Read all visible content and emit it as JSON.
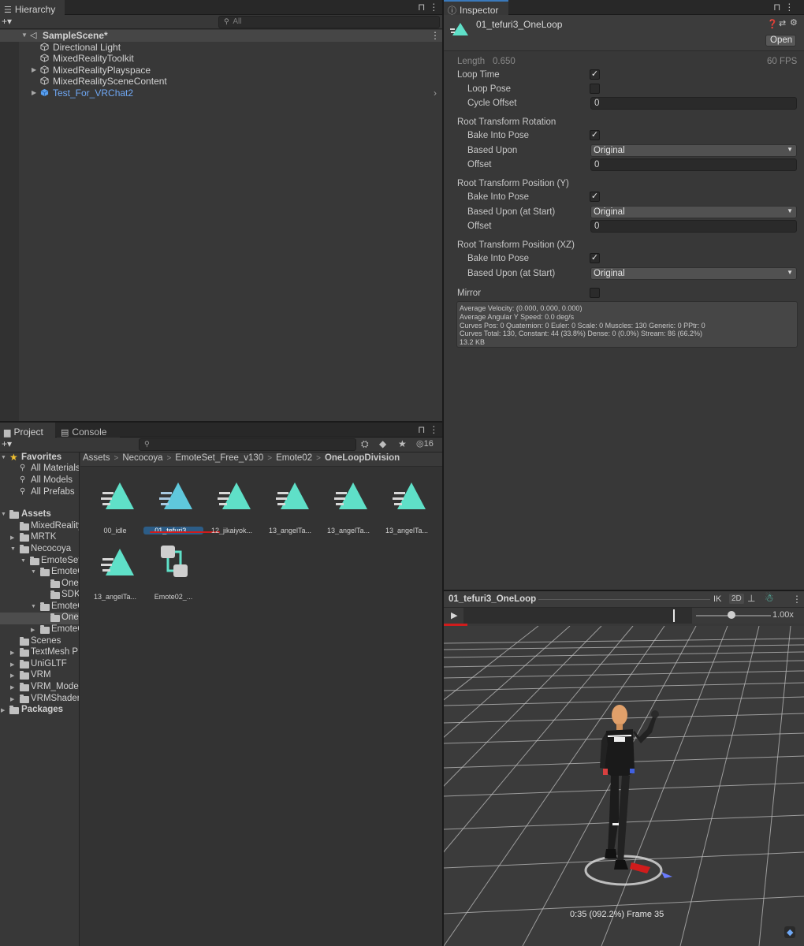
{
  "hierarchy": {
    "tab_label": "Hierarchy",
    "search_placeholder": "All",
    "add_label": "+▾",
    "scene_name": "SampleScene*",
    "items": [
      {
        "label": "Directional Light"
      },
      {
        "label": "MixedRealityToolkit"
      },
      {
        "label": "MixedRealityPlayspace"
      },
      {
        "label": "MixedRealitySceneContent"
      },
      {
        "label": "Test_For_VRChat2"
      }
    ]
  },
  "inspector": {
    "tab_label": "Inspector",
    "asset_name": "01_tefuri3_OneLoop",
    "open_button": "Open",
    "length_label": "Length",
    "length_value": "0.650",
    "fps_label": "60 FPS",
    "loop_time": {
      "label": "Loop Time",
      "checked": true
    },
    "loop_pose": {
      "label": "Loop Pose",
      "checked": false
    },
    "cycle_offset": {
      "label": "Cycle Offset",
      "value": "0"
    },
    "rotation": {
      "header": "Root Transform Rotation",
      "bake_label": "Bake Into Pose",
      "bake_checked": true,
      "based_label": "Based Upon",
      "based_value": "Original",
      "offset_label": "Offset",
      "offset_value": "0"
    },
    "position_y": {
      "header": "Root Transform Position (Y)",
      "bake_label": "Bake Into Pose",
      "bake_checked": true,
      "based_label": "Based Upon (at Start)",
      "based_value": "Original",
      "offset_label": "Offset",
      "offset_value": "0"
    },
    "position_xz": {
      "header": "Root Transform Position (XZ)",
      "bake_label": "Bake Into Pose",
      "bake_checked": true,
      "based_label": "Based Upon (at Start)",
      "based_value": "Original"
    },
    "mirror": {
      "label": "Mirror",
      "checked": false
    },
    "info_lines": [
      "Average Velocity: (0.000, 0.000, 0.000)",
      "Average Angular Y Speed: 0.0 deg/s",
      "Curves Pos: 0 Quaternion: 0 Euler: 0 Scale: 0 Muscles: 130 Generic: 0 PPtr: 0",
      "Curves Total: 130, Constant: 44 (33.8%) Dense: 0 (0.0%) Stream: 86 (66.2%)",
      "13.2 KB"
    ]
  },
  "project": {
    "tab_label": "Project",
    "console_tab_label": "Console",
    "hidden_count": "16",
    "breadcrumb": [
      "Assets",
      "Necocoya",
      "EmoteSet_Free_v130",
      "Emote02",
      "OneLoopDivision"
    ],
    "favorites": {
      "label": "Favorites",
      "items": [
        "All Materials",
        "All Models",
        "All Prefabs"
      ]
    },
    "tree": [
      {
        "label": "Assets",
        "depth": 0,
        "expanded": true,
        "bold": true
      },
      {
        "label": "MixedReality",
        "depth": 1,
        "expanded": false
      },
      {
        "label": "MRTK",
        "depth": 1,
        "expanded": false
      },
      {
        "label": "Necocoya",
        "depth": 1,
        "expanded": true
      },
      {
        "label": "EmoteSet",
        "depth": 2,
        "expanded": true
      },
      {
        "label": "EmoteC",
        "depth": 3,
        "expanded": true
      },
      {
        "label": "One",
        "depth": 4,
        "expanded": null
      },
      {
        "label": "SDK",
        "depth": 4,
        "expanded": null
      },
      {
        "label": "EmoteC",
        "depth": 3,
        "expanded": true
      },
      {
        "label": "One",
        "depth": 4,
        "expanded": null,
        "selected": true
      },
      {
        "label": "EmoteC",
        "depth": 3,
        "expanded": false
      },
      {
        "label": "Scenes",
        "depth": 1,
        "expanded": null
      },
      {
        "label": "TextMesh P",
        "depth": 1,
        "expanded": false
      },
      {
        "label": "UniGLTF",
        "depth": 1,
        "expanded": false
      },
      {
        "label": "VRM",
        "depth": 1,
        "expanded": false
      },
      {
        "label": "VRM_Models",
        "depth": 1,
        "expanded": false
      },
      {
        "label": "VRMShaders",
        "depth": 1,
        "expanded": false
      },
      {
        "label": "Packages",
        "depth": 0,
        "expanded": false,
        "bold": true
      }
    ],
    "assets": [
      {
        "label": "00_idle",
        "kind": "anim"
      },
      {
        "label": "01_tefuri3...",
        "kind": "anim",
        "selected": true
      },
      {
        "label": "12_jikaiyok...",
        "kind": "anim"
      },
      {
        "label": "13_angelTa...",
        "kind": "anim"
      },
      {
        "label": "13_angelTa...",
        "kind": "anim"
      },
      {
        "label": "13_angelTa...",
        "kind": "anim"
      },
      {
        "label": "13_angelTa...",
        "kind": "anim"
      },
      {
        "label": "Emote02_...",
        "kind": "controller"
      }
    ]
  },
  "preview": {
    "title": "01_tefuri3_OneLoop",
    "ik_label": "IK",
    "mode_2d_label": "2D",
    "speed_label": "1.00x",
    "status": "0:35 (092.2%) Frame 35"
  },
  "colors": {
    "accent_blue": "#3a79bb",
    "anim_icon": "#5fe0c8",
    "selection_underline": "#d01c1c",
    "prefab_blue": "#6fa8f5"
  }
}
